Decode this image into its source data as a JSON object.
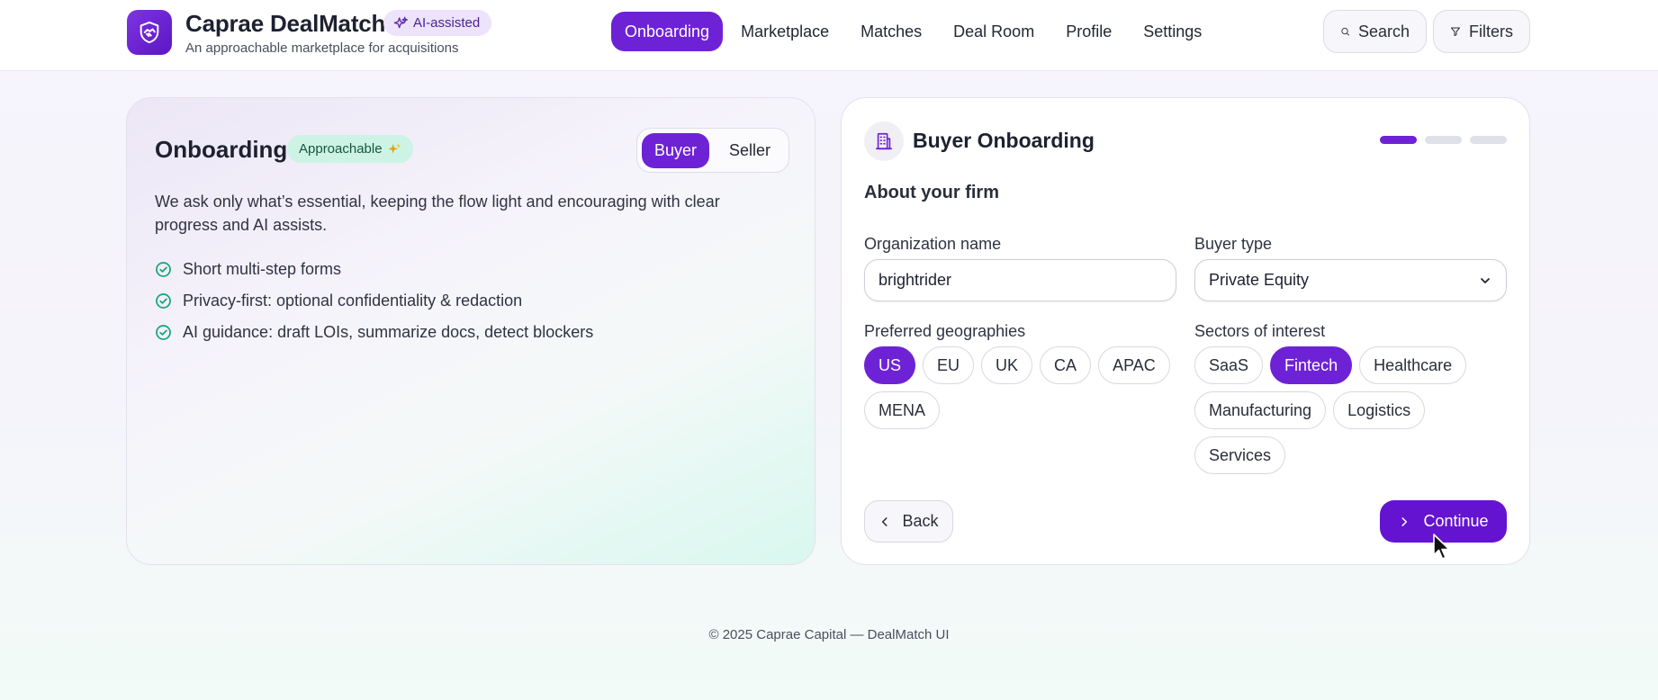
{
  "header": {
    "brand_title": "Caprae DealMatch",
    "brand_subtitle": "An approachable marketplace for acquisitions",
    "ai_badge": "AI-assisted",
    "nav": [
      {
        "label": "Onboarding",
        "active": true
      },
      {
        "label": "Marketplace",
        "active": false
      },
      {
        "label": "Matches",
        "active": false
      },
      {
        "label": "Deal Room",
        "active": false
      },
      {
        "label": "Profile",
        "active": false
      },
      {
        "label": "Settings",
        "active": false
      }
    ],
    "search_label": "Search",
    "filters_label": "Filters"
  },
  "left_panel": {
    "title": "Onboarding",
    "badge": "Approachable",
    "role_toggle": {
      "buyer": "Buyer",
      "seller": "Seller",
      "selected": "Buyer"
    },
    "description": "We ask only what’s essential, keeping the flow light and encouraging with clear progress and AI assists.",
    "bullets": [
      "Short multi-step forms",
      "Privacy-first: optional confidentiality & redaction",
      "AI guidance: draft LOIs, summarize docs, detect blockers"
    ]
  },
  "right_panel": {
    "title": "Buyer Onboarding",
    "progress": {
      "current_step": 1,
      "total_steps": 3
    },
    "section_title": "About your firm",
    "org_name_label": "Organization name",
    "org_name_value": "brightrider",
    "buyer_type_label": "Buyer type",
    "buyer_type_value": "Private Equity",
    "geographies_label": "Preferred geographies",
    "geographies": [
      {
        "label": "US",
        "selected": true
      },
      {
        "label": "EU",
        "selected": false
      },
      {
        "label": "UK",
        "selected": false
      },
      {
        "label": "CA",
        "selected": false
      },
      {
        "label": "APAC",
        "selected": false
      },
      {
        "label": "MENA",
        "selected": false
      }
    ],
    "sectors_label": "Sectors of interest",
    "sectors": [
      {
        "label": "SaaS",
        "selected": false
      },
      {
        "label": "Fintech",
        "selected": true
      },
      {
        "label": "Healthcare",
        "selected": false
      },
      {
        "label": "Manufacturing",
        "selected": false
      },
      {
        "label": "Logistics",
        "selected": false
      },
      {
        "label": "Services",
        "selected": false
      }
    ],
    "back_label": "Back",
    "continue_label": "Continue"
  },
  "footer": {
    "text": "© 2025 Caprae Capital — DealMatch UI"
  },
  "colors": {
    "accent": "#6e22d6",
    "success": "#14a37a",
    "badge_green": "#cdf3e4"
  },
  "icons": [
    "handshake-shield-icon",
    "sparkles-icon",
    "search-icon",
    "filter-icon",
    "check-circle-icon",
    "building-icon",
    "chevron-down-icon",
    "chevron-left-icon",
    "chevron-right-icon",
    "mouse-cursor-icon"
  ]
}
